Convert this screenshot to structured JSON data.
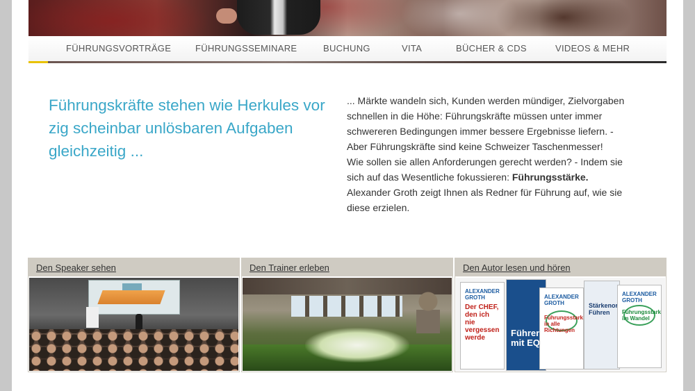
{
  "nav": {
    "items": [
      {
        "label": "FÜHRUNGSVORTRÄGE"
      },
      {
        "label": "FÜHRUNGSSEMINARE"
      },
      {
        "label": "BUCHUNG"
      },
      {
        "label": "VITA"
      },
      {
        "label": "BÜCHER & CDS"
      },
      {
        "label": "VIDEOS & MEHR"
      }
    ]
  },
  "headline": "Führungskräfte stehen wie Herkules vor zig scheinbar unlösbaren Aufgaben gleichzeitig ...",
  "intro": {
    "part1": "... Märkte wandeln sich, Kunden werden mündiger, Zielvorgaben schnellen in die Höhe: Führungskräfte müssen unter immer schwereren Bedingungen immer bessere Ergebnisse liefern. - Aber Führungskräfte sind keine Schweizer Taschenmesser!",
    "part2": "Wie sollen sie allen Anforderungen gerecht werden? - Indem sie sich auf das Wesentliche fokussieren: ",
    "bold": "Führungsstärke.",
    "part3": "Alexander Groth zeigt Ihnen als Redner für Führung auf, wie sie diese erzielen."
  },
  "teasers": [
    {
      "label": "Den Speaker sehen"
    },
    {
      "label": "Den Trainer erleben"
    },
    {
      "label": "Den Autor lesen und hören"
    }
  ],
  "books": {
    "author": "ALEXANDER GROTH",
    "book1_title": "Der CHEF, den ich nie vergessen werde",
    "book2_title": "Führungsstark in alle Richtungen",
    "book3_title": "Führen mit EQ",
    "book4_title": "Stärkenorientiertes Führen",
    "book5_title": "Führungsstark im Wandel"
  }
}
